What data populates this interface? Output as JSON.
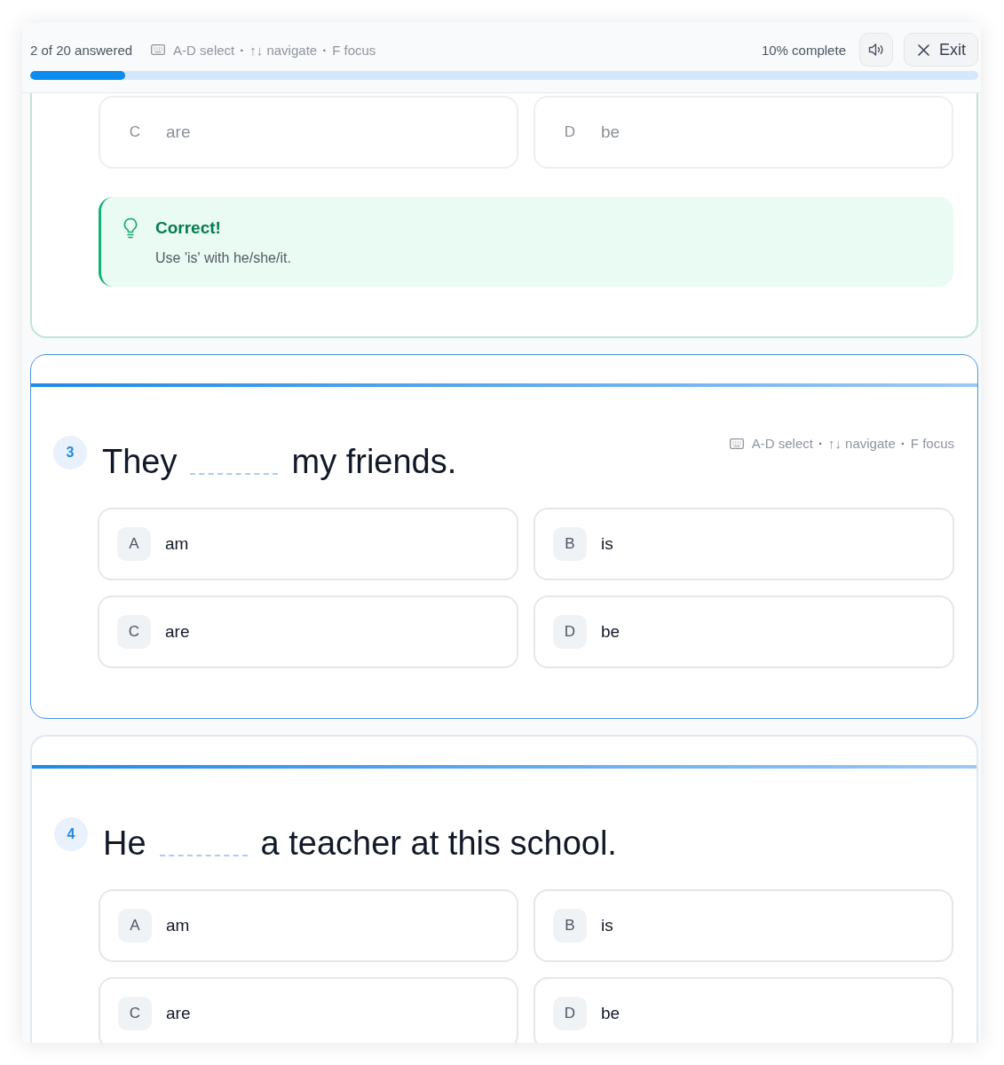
{
  "header": {
    "answered": "2 of 20 answered",
    "keyboard_hints": [
      {
        "kind": "hint",
        "text": "A-D select"
      },
      {
        "kind": "separator",
        "text": "·"
      },
      {
        "kind": "hint",
        "text": "↑↓ navigate"
      },
      {
        "kind": "separator",
        "text": "·"
      },
      {
        "kind": "hint",
        "text": "F focus"
      }
    ],
    "complete": "10% complete",
    "exit_label": "Exit"
  },
  "progress": {
    "level": 0.1
  },
  "questions": [
    {
      "selected": false,
      "answered": true,
      "options": [
        {
          "letter": "C",
          "text": "are",
          "disabled": true,
          "selected": false
        },
        {
          "letter": "D",
          "text": "be",
          "disabled": true,
          "selected": false
        }
      ],
      "feedback": {
        "kind": "correct",
        "title": "Correct!",
        "text": "Use 'is' with he/she/it."
      }
    },
    {
      "selected": true,
      "answered": false,
      "number": "3",
      "before": "They",
      "after": "my friends.",
      "keyboard_hints": [
        {
          "kind": "hint",
          "text": "A-D select"
        },
        {
          "kind": "separator",
          "text": "·"
        },
        {
          "kind": "hint",
          "text": "↑↓ navigate"
        },
        {
          "kind": "separator",
          "text": "·"
        },
        {
          "kind": "hint",
          "text": "F focus"
        }
      ],
      "options": [
        {
          "letter": "A",
          "text": "am",
          "disabled": false,
          "selected": false
        },
        {
          "letter": "B",
          "text": "is",
          "disabled": false,
          "selected": false
        },
        {
          "letter": "C",
          "text": "are",
          "disabled": false,
          "selected": false
        },
        {
          "letter": "D",
          "text": "be",
          "disabled": false,
          "selected": false
        }
      ]
    },
    {
      "selected": false,
      "answered": false,
      "number": "4",
      "before": "He",
      "after": "a teacher at this school.",
      "options": [
        {
          "letter": "A",
          "text": "am",
          "disabled": false,
          "selected": false
        },
        {
          "letter": "B",
          "text": "is",
          "disabled": false,
          "selected": false
        },
        {
          "letter": "C",
          "text": "are",
          "disabled": false,
          "selected": false
        },
        {
          "letter": "D",
          "text": "be",
          "disabled": false,
          "selected": false
        }
      ]
    }
  ]
}
